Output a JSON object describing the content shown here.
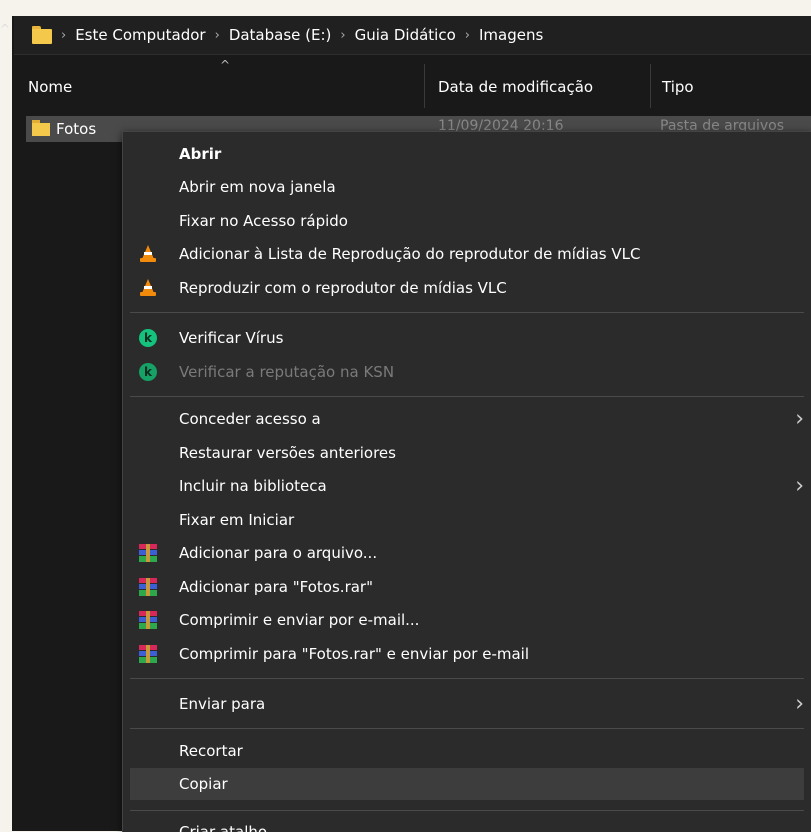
{
  "breadcrumb": [
    "Este Computador",
    "Database (E:)",
    "Guia Didático",
    "Imagens"
  ],
  "columns": {
    "name": "Nome",
    "date": "Data de modificação",
    "type": "Tipo"
  },
  "selected_row": {
    "name": "Fotos",
    "date": "11/09/2024 20:16",
    "type": "Pasta de arquivos"
  },
  "menu": {
    "abrir": "Abrir",
    "abrir_nova": "Abrir em nova janela",
    "fixar_acesso": "Fixar no Acesso rápido",
    "vlc_add": "Adicionar à Lista de Reprodução do reprodutor de mídias VLC",
    "vlc_play": "Reproduzir com o reprodutor de mídias VLC",
    "virus": "Verificar Vírus",
    "ksn": "Verificar a reputação na KSN",
    "conceder": "Conceder acesso a",
    "restaurar": "Restaurar versões anteriores",
    "incluir": "Incluir na biblioteca",
    "fixar_iniciar": "Fixar em Iniciar",
    "rar_add": "Adicionar para o arquivo...",
    "rar_add_named": "Adicionar para \"Fotos.rar\"",
    "rar_email": "Comprimir e enviar por e-mail...",
    "rar_email_named": "Comprimir para \"Fotos.rar\" e enviar por e-mail",
    "enviar": "Enviar para",
    "recortar": "Recortar",
    "copiar": "Copiar",
    "atalho": "Criar atalho"
  },
  "icons": {
    "vlc": "vlc-cone-icon",
    "kaspersky": "kaspersky-icon",
    "winrar": "winrar-icon",
    "kaspersky_glyph": "k",
    "submenu_arrow": "›"
  },
  "colors": {
    "menu_bg": "#2b2b2b",
    "hover_bg": "#3d3d3d",
    "folder": "#f4c84a",
    "disabled_text": "#7a7a7a"
  }
}
